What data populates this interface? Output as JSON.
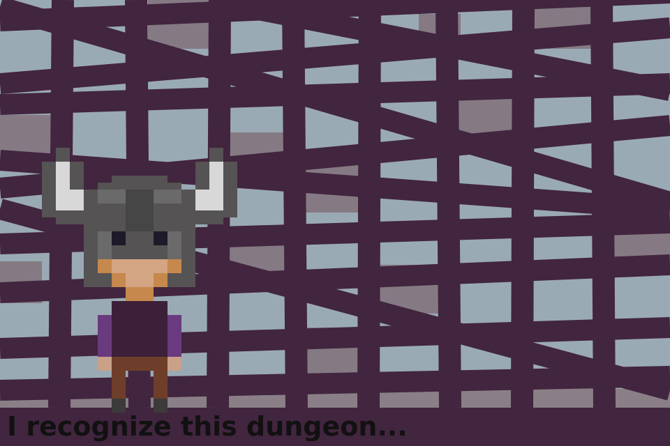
{
  "dialogue": {
    "text": "I recognize this dungeon..."
  },
  "colors": {
    "bars": "#42253f",
    "sky": "#9aaab4",
    "stone": "#857a83",
    "floor": "#8a7f87",
    "text": "#111111"
  },
  "icons": {
    "character": "horned-helmet-knight-sprite"
  }
}
